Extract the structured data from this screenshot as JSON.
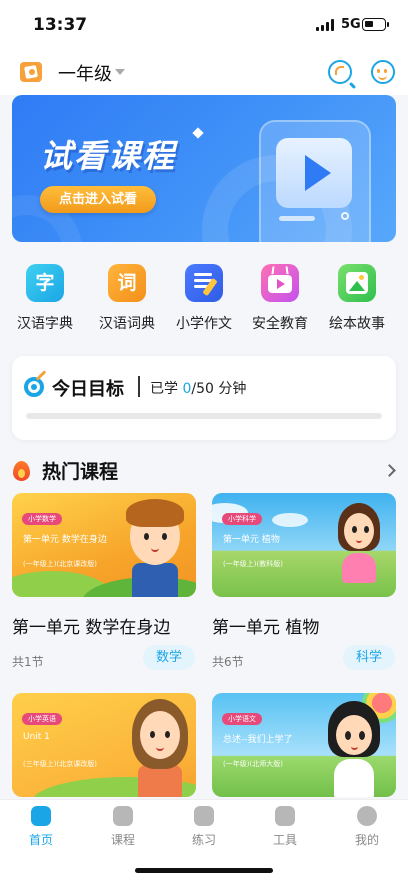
{
  "status_bar": {
    "time": "13:37",
    "network": "5G"
  },
  "header": {
    "grade": "一年级"
  },
  "banner": {
    "title": "试看课程",
    "button_label": "点击进入试看"
  },
  "categories": [
    {
      "label": "汉语字典",
      "glyph": "字",
      "icon": "character-icon"
    },
    {
      "label": "汉语词典",
      "glyph": "词",
      "icon": "word-icon"
    },
    {
      "label": "小学作文",
      "icon": "notepad-pencil-icon"
    },
    {
      "label": "安全教育",
      "icon": "tv-play-icon"
    },
    {
      "label": "绘本故事",
      "icon": "picture-icon"
    }
  ],
  "goal": {
    "title": "今日目标",
    "learned_prefix": "已学 ",
    "current": "0",
    "rest": "/50 分钟",
    "progress": 0
  },
  "hot": {
    "title": "热门课程",
    "courses": [
      {
        "title": "第一单元 数学在身边",
        "count": "共1节",
        "subject": "数学",
        "thumb": {
          "tag": "小学数学",
          "line1": "第一单元 数学在身边",
          "line2": "(一年级上)(北京课改版)"
        }
      },
      {
        "title": "第一单元 植物",
        "count": "共6节",
        "subject": "科学",
        "thumb": {
          "tag": "小学科学",
          "line1": "第一单元 植物",
          "line2": "(一年级上)(教科版)"
        }
      },
      {
        "thumb": {
          "tag": "小学英语",
          "line1": "Unit 1",
          "line2": "(三年级上)(北京课改版)"
        }
      },
      {
        "thumb": {
          "tag": "小学语文",
          "line1": "总述--我们上学了",
          "line2": "(一年级)(北师大版)"
        }
      }
    ]
  },
  "tabs": [
    {
      "label": "首页",
      "active": true
    },
    {
      "label": "课程"
    },
    {
      "label": "练习"
    },
    {
      "label": "工具"
    },
    {
      "label": "我的"
    }
  ],
  "colors": {
    "accent": "#1aa6e6",
    "banner_blue": "#2f7bf5",
    "cta_orange": "#f6a13a"
  }
}
